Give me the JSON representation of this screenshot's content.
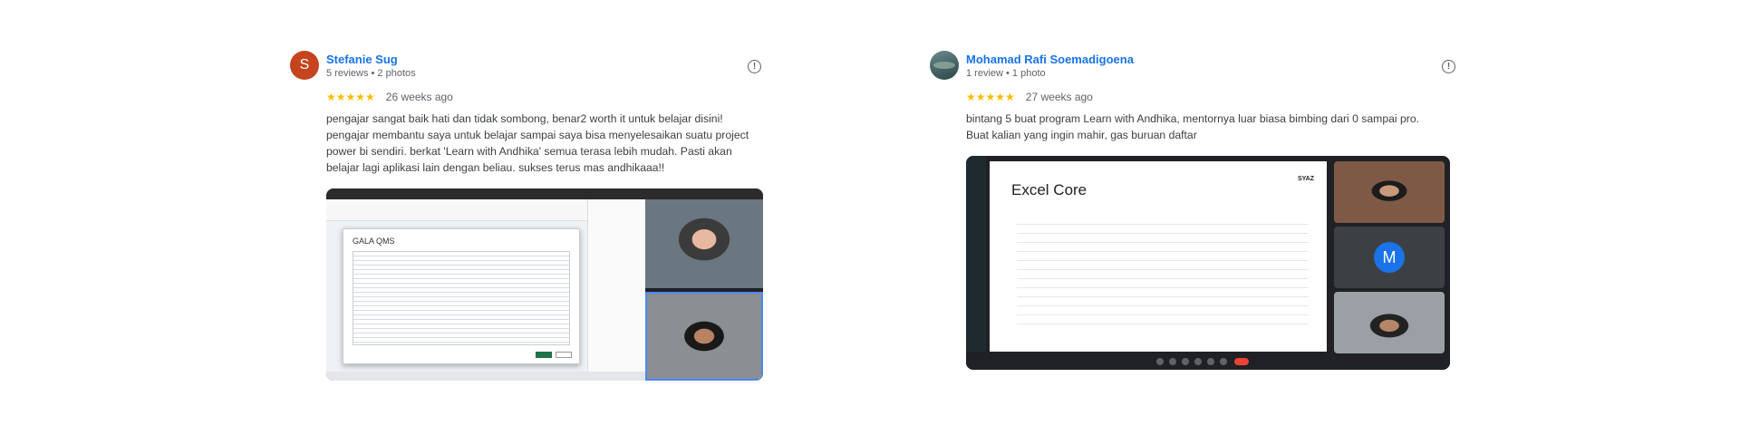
{
  "reviews": [
    {
      "avatar_letter": "S",
      "name": "Stefanie Sug",
      "meta": "5 reviews • 2 photos",
      "stars": "★★★★★",
      "ago": "26 weeks ago",
      "text": "pengajar sangat baik hati dan tidak sombong, benar2 worth it untuk belajar disini! pengajar membantu saya untuk belajar sampai saya bisa menyelesaikan suatu project power bi sendiri. berkat 'Learn with Andhika' semua terasa lebih mudah. Pasti akan belajar lagi aplikasi lain dengan beliau. sukses terus mas andhikaaa!!",
      "photo": {
        "dialog_title": "GALA QMS"
      }
    },
    {
      "name": "Mohamad Rafi Soemadigoena",
      "meta": "1 review • 1 photo",
      "stars": "★★★★★",
      "ago": "27 weeks ago",
      "text": "bintang 5 buat program Learn with Andhika, mentornya luar biasa bimbing dari 0 sampai pro. Buat kalian yang ingin mahir, gas buruan daftar",
      "photo": {
        "slide_title": "Excel Core",
        "slide_brand": "SYAZ",
        "participant_initial": "M"
      }
    }
  ],
  "report_icon": "!",
  "colors": {
    "link": "#1a73e8",
    "star": "#fbbc04",
    "avatar_s": "#c5441f"
  }
}
